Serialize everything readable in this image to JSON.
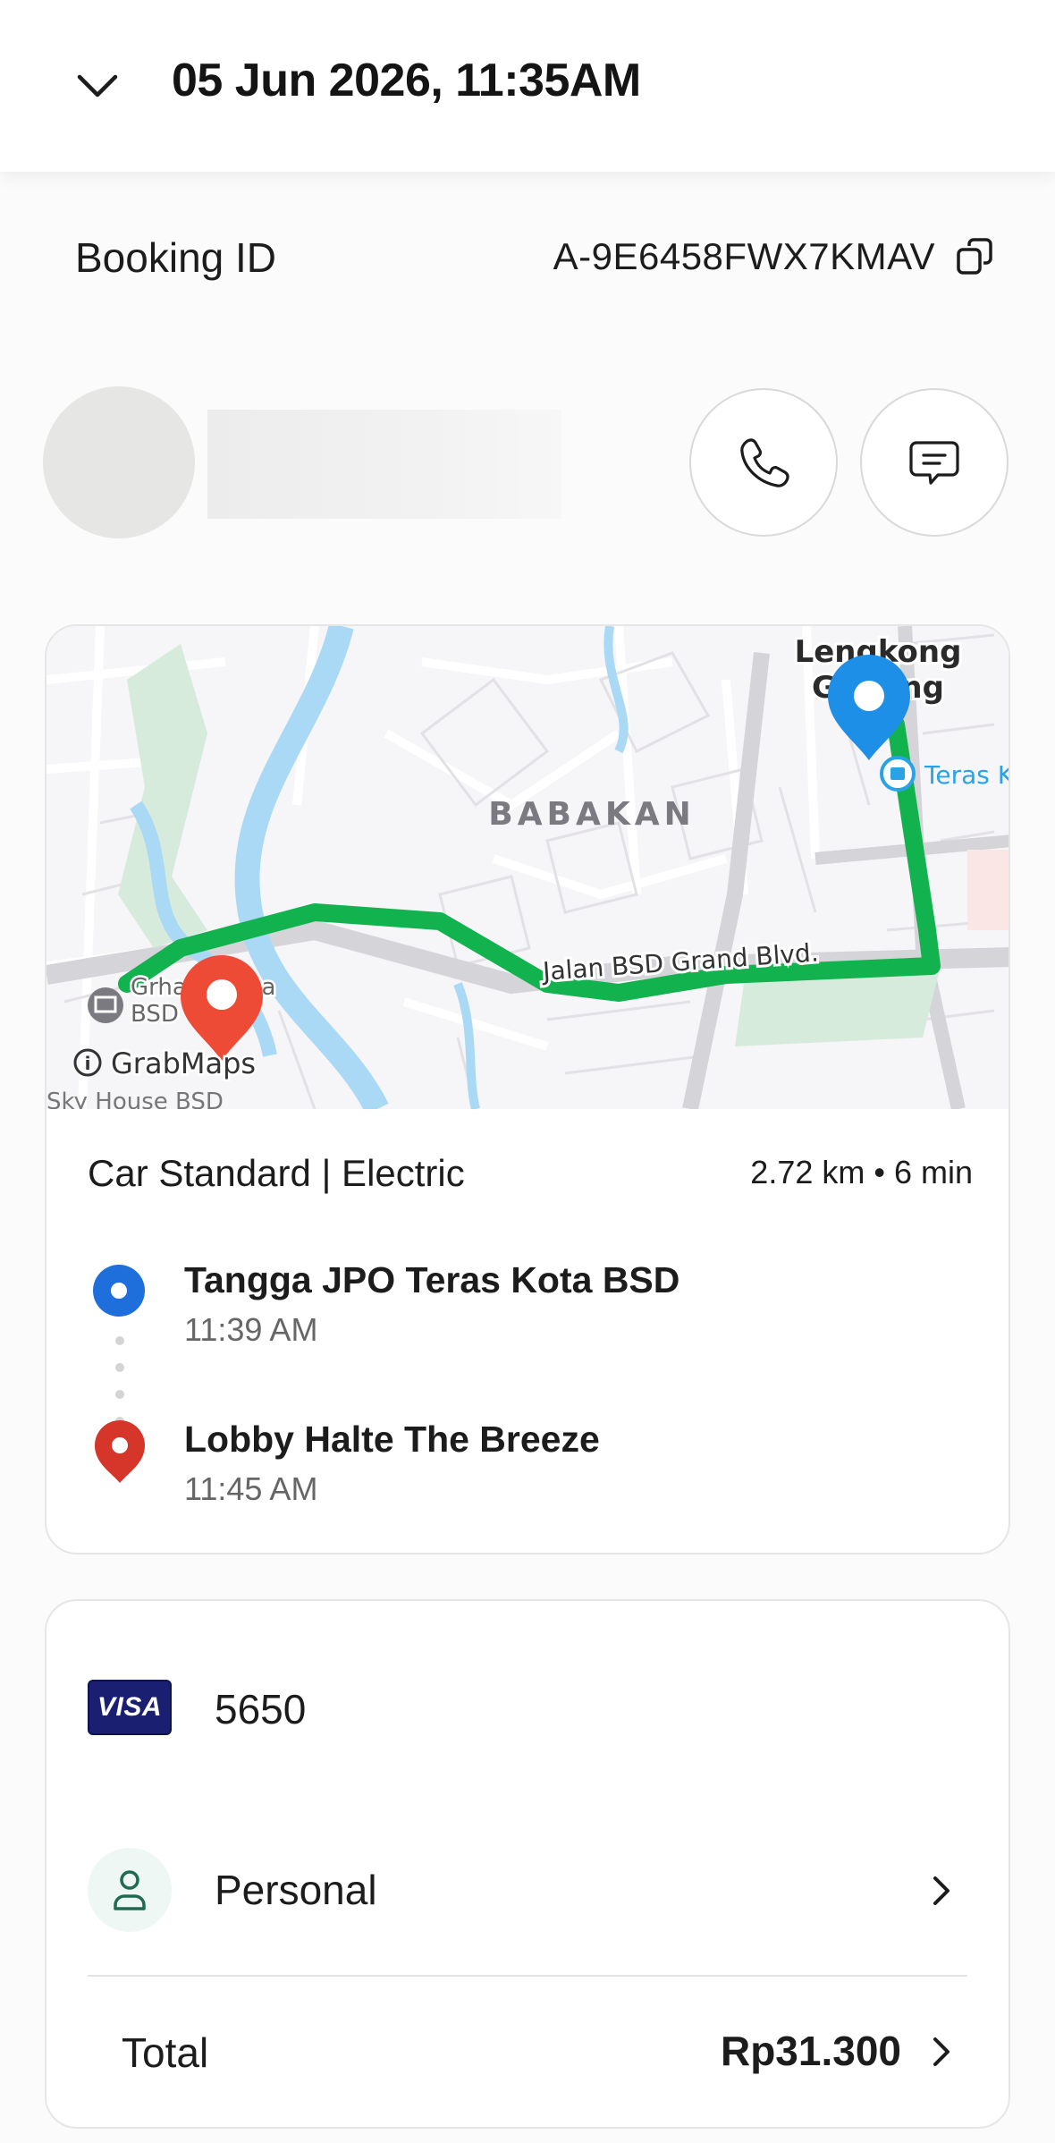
{
  "header": {
    "title": "05 Jun 2026, 11:35AM",
    "chevron_icon": "chevron-down-icon"
  },
  "booking": {
    "label": "Booking ID",
    "id": "A-9E6458FWX7KMAV",
    "copy_icon": "copy-icon"
  },
  "driver": {
    "call_icon": "phone-icon",
    "chat_icon": "chat-icon"
  },
  "map": {
    "area_label": "BABAKAN",
    "road_label": "Jalan BSD Grand Blvd.",
    "pickup_area": [
      "Lengkong",
      "Gudang"
    ],
    "poi_right": "Teras K",
    "poi_left": [
      "Grha Wisesa",
      "BSD"
    ],
    "poi_bottom": "Sky House BSD",
    "provider": "GrabMaps",
    "route_color": "#12b24f",
    "pickup_pin_color": "#1e8fe6",
    "dropoff_pin_color": "#ee4b36"
  },
  "trip": {
    "ride_type": "Car Standard | Electric",
    "distance": "2.72 km",
    "duration": "6 min",
    "pickup": {
      "name": "Tangga JPO Teras Kota BSD",
      "time": "11:39 AM"
    },
    "dropoff": {
      "name": "Lobby Halte The Breeze",
      "time": "11:45 AM"
    }
  },
  "payment": {
    "card_brand": "VISA",
    "card_last4": "5650",
    "profile": "Personal",
    "profile_icon": "person-icon",
    "total_label": "Total",
    "total_value": "Rp31.300"
  }
}
